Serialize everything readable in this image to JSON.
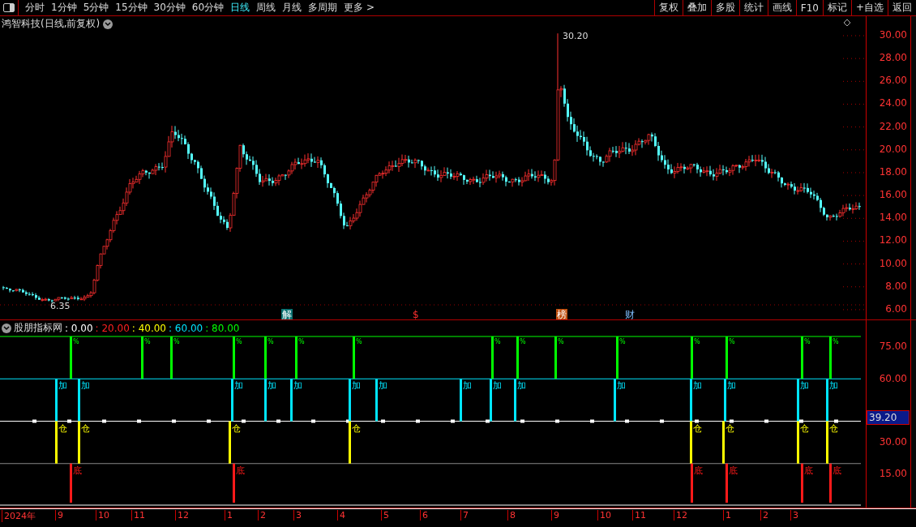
{
  "toolbar": {
    "periods": [
      {
        "label": "分时",
        "selected": false
      },
      {
        "label": "1分钟",
        "selected": false
      },
      {
        "label": "5分钟",
        "selected": false
      },
      {
        "label": "15分钟",
        "selected": false
      },
      {
        "label": "30分钟",
        "selected": false
      },
      {
        "label": "60分钟",
        "selected": false
      },
      {
        "label": "日线",
        "selected": true
      },
      {
        "label": "周线",
        "selected": false
      },
      {
        "label": "月线",
        "selected": false
      },
      {
        "label": "多周期",
        "selected": false
      },
      {
        "label": "更多 >",
        "selected": false
      }
    ],
    "buttons": [
      "复权",
      "叠加",
      "多股",
      "统计",
      "画线",
      "F10",
      "标记",
      "+自选",
      "返回"
    ]
  },
  "price_panel": {
    "title": "鸿智科技(日线,前复权)",
    "high_label": "30.20",
    "low_label": "6.35",
    "events": [
      {
        "label": "解",
        "kind": "tag"
      },
      {
        "label": "$",
        "kind": "text"
      },
      {
        "label": "榜",
        "kind": "tag"
      },
      {
        "label": "财",
        "kind": "text"
      }
    ],
    "axis": [
      "30.00",
      "28.00",
      "26.00",
      "24.00",
      "22.00",
      "20.00",
      "18.00",
      "16.00",
      "14.00",
      "12.00",
      "10.00",
      "8.00",
      "6.00"
    ]
  },
  "indicator_panel": {
    "name": "股朋指标网",
    "legend": [
      {
        "text": ": 0.00",
        "color": "#ffffff"
      },
      {
        "text": ": 20.00",
        "color": "#ff2020"
      },
      {
        "text": ": 40.00",
        "color": "#ffff00"
      },
      {
        "text": ": 60.00",
        "color": "#00e5ff"
      },
      {
        "text": ": 80.00",
        "color": "#00ff00"
      }
    ],
    "axis": [
      "75.00",
      "60.00",
      "30.00",
      "15.00"
    ],
    "current_value": "39.20",
    "signals": [
      {
        "kind": "top",
        "label": "%"
      },
      {
        "kind": "top",
        "label": "%"
      },
      {
        "kind": "top",
        "label": "%"
      },
      {
        "kind": "top",
        "label": "%"
      },
      {
        "kind": "top",
        "label": "%"
      },
      {
        "kind": "top",
        "label": "%"
      },
      {
        "kind": "top",
        "label": "%"
      },
      {
        "kind": "top",
        "label": "%"
      },
      {
        "kind": "top",
        "label": "%"
      },
      {
        "kind": "top",
        "label": "%"
      },
      {
        "kind": "top",
        "label": "%"
      },
      {
        "kind": "top",
        "label": "%"
      },
      {
        "kind": "top",
        "label": "%"
      },
      {
        "kind": "top",
        "label": "%"
      },
      {
        "kind": "top",
        "label": "%"
      },
      {
        "kind": "add",
        "label": "加"
      },
      {
        "kind": "add",
        "label": "加"
      },
      {
        "kind": "add",
        "label": "加"
      },
      {
        "kind": "add",
        "label": "加"
      },
      {
        "kind": "add",
        "label": "加"
      },
      {
        "kind": "add",
        "label": "加"
      },
      {
        "kind": "add",
        "label": "加"
      },
      {
        "kind": "add",
        "label": "加"
      },
      {
        "kind": "add",
        "label": "加"
      },
      {
        "kind": "add",
        "label": "加"
      },
      {
        "kind": "add",
        "label": "加"
      },
      {
        "kind": "add",
        "label": "加"
      },
      {
        "kind": "add",
        "label": "加"
      },
      {
        "kind": "add",
        "label": "加"
      },
      {
        "kind": "add",
        "label": "加"
      },
      {
        "kind": "mid",
        "label": "仓"
      },
      {
        "kind": "mid",
        "label": "仓"
      },
      {
        "kind": "mid",
        "label": "仓"
      },
      {
        "kind": "mid",
        "label": "仓"
      },
      {
        "kind": "mid",
        "label": "仓"
      },
      {
        "kind": "mid",
        "label": "仓"
      },
      {
        "kind": "mid",
        "label": "仓"
      },
      {
        "kind": "mid",
        "label": "仓"
      },
      {
        "kind": "bottom",
        "label": "底"
      },
      {
        "kind": "bottom",
        "label": "底"
      },
      {
        "kind": "bottom",
        "label": "底"
      },
      {
        "kind": "bottom",
        "label": "底"
      },
      {
        "kind": "bottom",
        "label": "底"
      },
      {
        "kind": "bottom",
        "label": "底"
      }
    ]
  },
  "time_axis": [
    "2024年",
    "9",
    "10",
    "11",
    "12",
    "1",
    "2",
    "3",
    "4",
    "5",
    "6",
    "7",
    "8",
    "9",
    "10",
    "11",
    "12",
    "1",
    "2",
    "3"
  ]
}
